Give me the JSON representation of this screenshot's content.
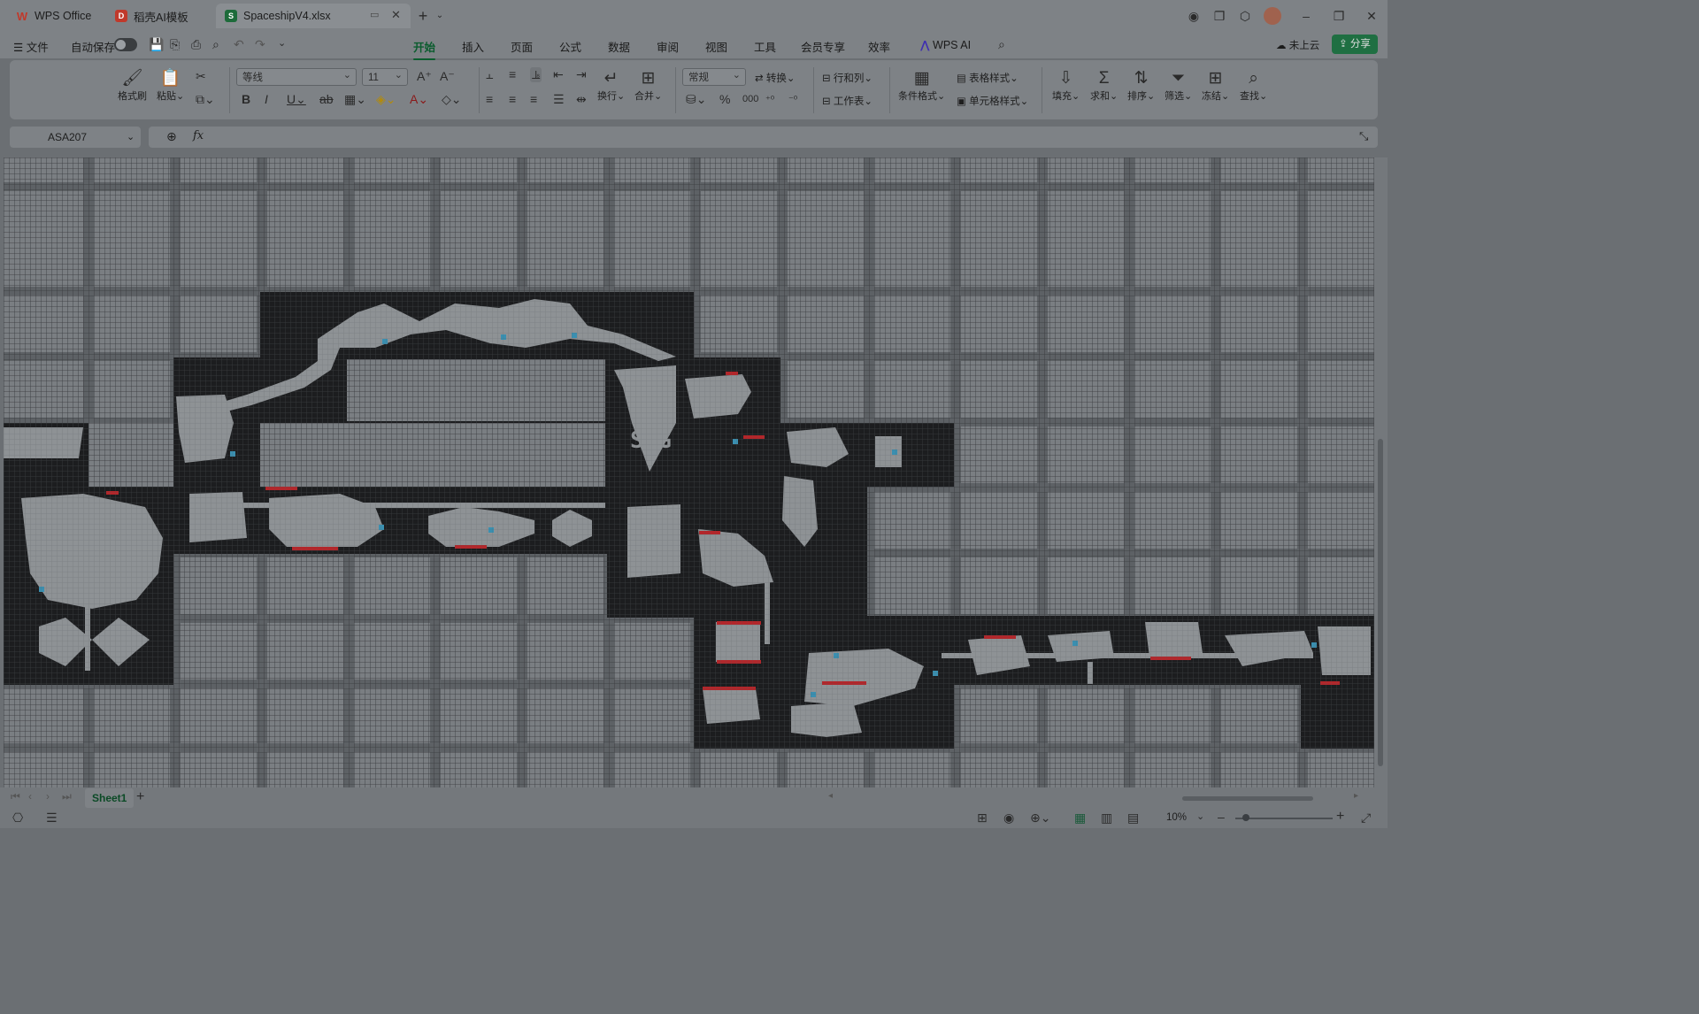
{
  "titlebar": {
    "tabs": [
      {
        "label": "WPS Office",
        "icon": "wps-logo-icon",
        "color": "#c0392b"
      },
      {
        "label": "稻壳AI模板",
        "icon": "docer-icon",
        "color": "#c0392b"
      },
      {
        "label": "SpaceshipV4.xlsx",
        "icon": "spreadsheet-icon",
        "color": "#1d6b3a"
      }
    ]
  },
  "menubar": {
    "file": "文件",
    "autosave": "自动保存",
    "tabs": [
      "开始",
      "插入",
      "页面",
      "公式",
      "数据",
      "审阅",
      "视图",
      "工具",
      "会员专享",
      "效率"
    ],
    "active_tab": "开始",
    "wps_ai": "WPS AI",
    "cloud": "未上云",
    "share": "分享"
  },
  "ribbon": {
    "format_painter": "格式刷",
    "paste": "粘贴",
    "font_name": "等线",
    "font_size": "11",
    "wrap": "换行",
    "merge": "合并",
    "number_format": "常规",
    "convert": "转换",
    "rows_cols": "行和列",
    "worksheet": "工作表",
    "cond_format": "条件格式",
    "table_style": "表格样式",
    "cell_style": "单元格样式",
    "fill": "填充",
    "sum": "求和",
    "sort": "排序",
    "filter": "筛选",
    "freeze": "冻结",
    "find": "查找"
  },
  "formula": {
    "name_box": "ASA207",
    "fx": "fx",
    "content": ""
  },
  "sheet": {
    "map_label": "SBG",
    "colors": {
      "hull": "#1c1d1f",
      "floor": "#8e9295",
      "door": "#b3262a",
      "accent": "#3a8fb0"
    }
  },
  "sheetbar": {
    "tabs": [
      "Sheet1"
    ],
    "add": "+"
  },
  "statusbar": {
    "zoom": "10%"
  }
}
